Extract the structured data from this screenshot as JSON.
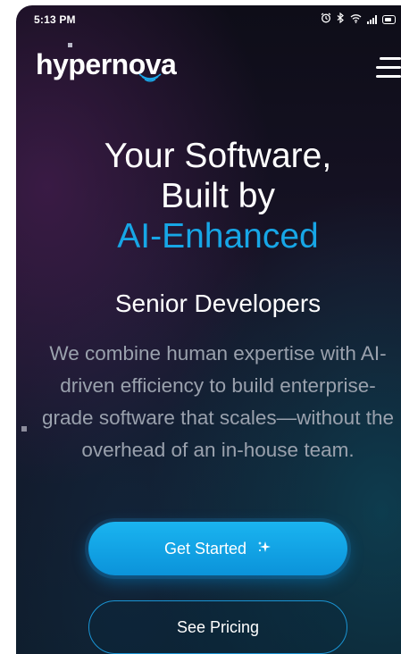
{
  "status_bar": {
    "time": "5:13 PM",
    "icons": [
      "alarm-icon",
      "bluetooth-icon",
      "wifi-icon",
      "signal-icon",
      "battery-icon"
    ]
  },
  "header": {
    "logo_text": "hypernova",
    "menu_icon": "hamburger-menu-icon"
  },
  "hero": {
    "title_line1": "Your Software,",
    "title_line2": "Built by",
    "title_accent": "AI-Enhanced",
    "subtitle": "Senior Developers",
    "description": "We combine human expertise with AI-driven efficiency to build enterprise-grade software that scales—without the overhead of an in-house team."
  },
  "actions": {
    "primary_label": "Get Started",
    "primary_icon": "sparkle-icon",
    "secondary_label": "See Pricing"
  },
  "colors": {
    "accent": "#17a6e6",
    "button_primary": "#1ab4f0",
    "background": "#0e0d18",
    "description_text": "#9aa1ad"
  }
}
